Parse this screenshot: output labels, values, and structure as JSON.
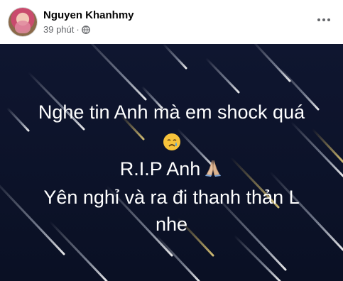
{
  "post": {
    "author": "Nguyen Khanhmy",
    "time": "39 phút",
    "separator": "·",
    "privacy_icon": "globe-icon",
    "more_icon": "more-options-icon",
    "background_colors": {
      "base": "#121a33",
      "streak": "#9aa3b5"
    },
    "text_lines": {
      "line1": "Nghe tin Anh mà em shock quá",
      "line3": "R.I.P Anh",
      "line4": "Yên nghỉ và ra đi thanh thản L",
      "line5": "nhe"
    },
    "emojis": [
      "crying-face-emoji",
      "folded-hands-emoji"
    ]
  }
}
